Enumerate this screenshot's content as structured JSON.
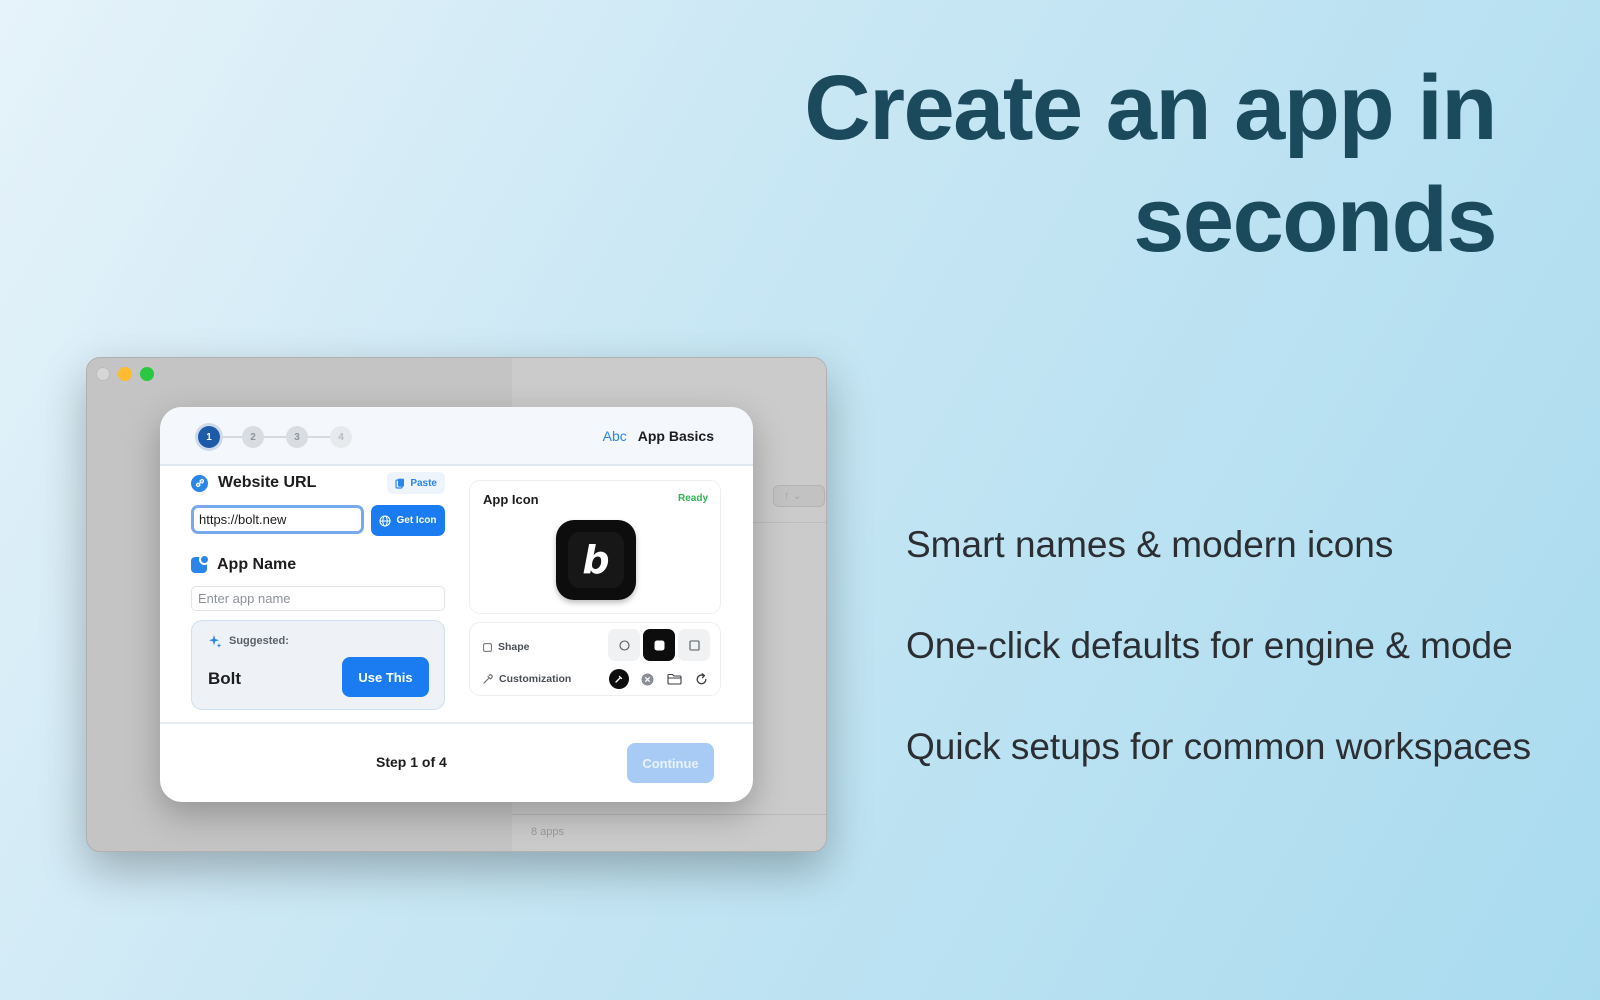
{
  "headline": {
    "line1": "Create an app in",
    "line2": "seconds"
  },
  "features": [
    "Smart names & modern icons",
    "One-click defaults for engine & mode",
    "Quick setups for common workspaces"
  ],
  "background_window": {
    "footer_text": "8 apps"
  },
  "dialog": {
    "steps": [
      "1",
      "2",
      "3",
      "4"
    ],
    "active_step": 1,
    "header_icon": "Abc",
    "header_title": "App Basics",
    "website_url": {
      "title": "Website URL",
      "paste_label": "Paste",
      "value": "https://bolt.new",
      "get_icon_label": "Get Icon"
    },
    "app_name": {
      "title": "App Name",
      "placeholder": "Enter app name",
      "suggested_label": "Suggested:",
      "suggested_value": "Bolt",
      "use_label": "Use This"
    },
    "app_icon": {
      "title": "App Icon",
      "status": "Ready",
      "glyph": "b"
    },
    "options": {
      "shape_label": "Shape",
      "customization_label": "Customization",
      "selected_shape": "rounded-square"
    },
    "footer": {
      "step_text": "Step 1 of 4",
      "continue_label": "Continue"
    }
  },
  "colors": {
    "accent": "#1a7cf0",
    "headline": "#1b4a5c",
    "ready": "#2fb453",
    "continue_disabled": "#a7cbf5"
  }
}
